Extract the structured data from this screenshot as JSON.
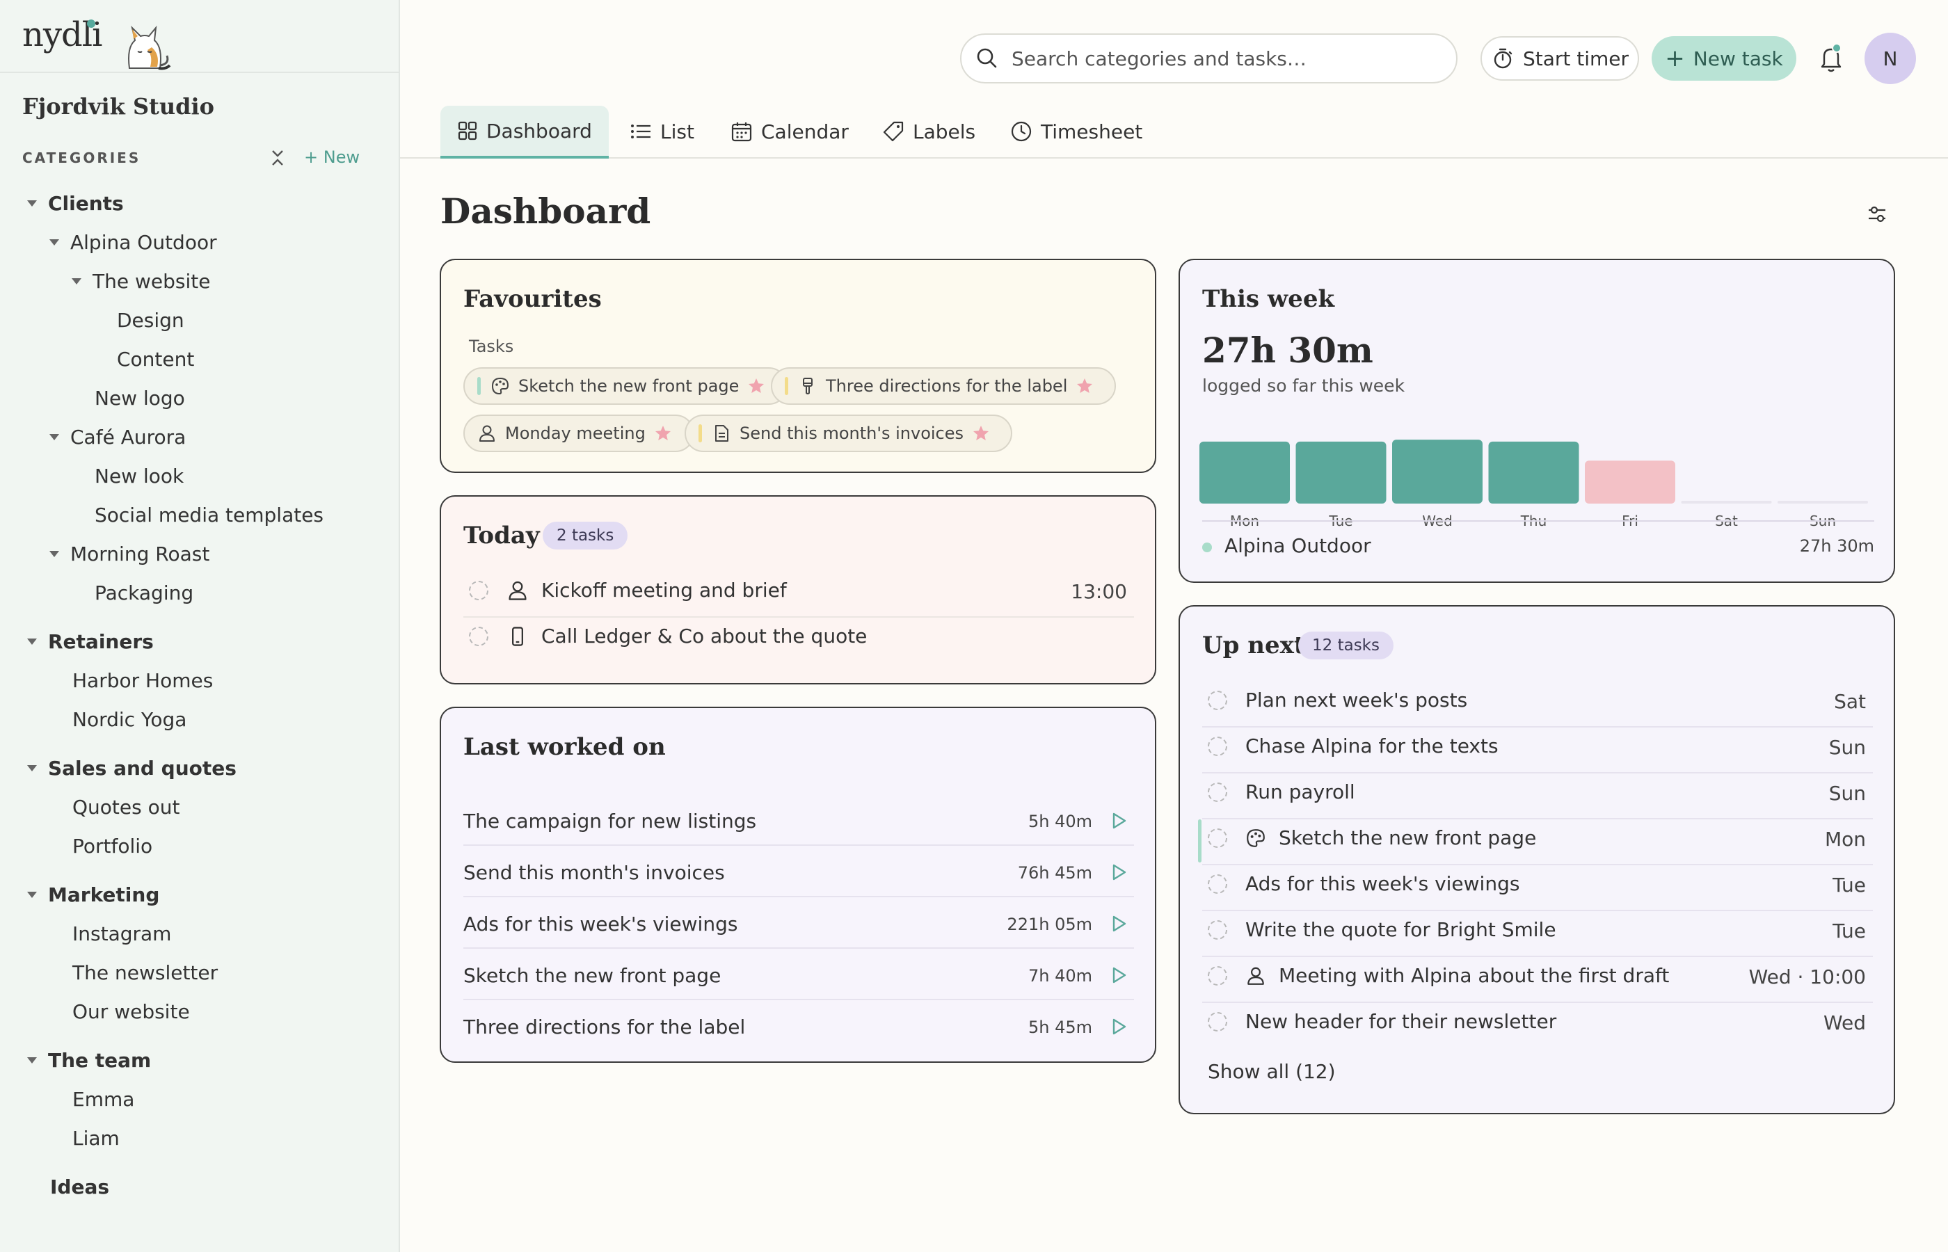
{
  "app": {
    "logo": "nydli",
    "workspace": "Fjordvik Studio"
  },
  "sidebar": {
    "categories_label": "CATEGORIES",
    "new_label": "+ New",
    "tree": [
      {
        "label": "Clients",
        "level": 0,
        "group": true,
        "caret": true
      },
      {
        "label": "Alpina Outdoor",
        "level": 1,
        "caret": true
      },
      {
        "label": "The website",
        "level": 2,
        "caret": true
      },
      {
        "label": "Design",
        "level": 3
      },
      {
        "label": "Content",
        "level": 3
      },
      {
        "label": "New logo",
        "level": 2
      },
      {
        "label": "Café Aurora",
        "level": 1,
        "caret": true
      },
      {
        "label": "New look",
        "level": 2
      },
      {
        "label": "Social media templates",
        "level": 2
      },
      {
        "label": "Morning Roast",
        "level": 1,
        "caret": true
      },
      {
        "label": "Packaging",
        "level": 2
      },
      {
        "label": "Retainers",
        "level": 0,
        "group": true,
        "caret": true
      },
      {
        "label": "Harbor Homes",
        "level": 1
      },
      {
        "label": "Nordic Yoga",
        "level": 1
      },
      {
        "label": "Sales and quotes",
        "level": 0,
        "group": true,
        "caret": true
      },
      {
        "label": "Quotes out",
        "level": 1
      },
      {
        "label": "Portfolio",
        "level": 1
      },
      {
        "label": "Marketing",
        "level": 0,
        "group": true,
        "caret": true
      },
      {
        "label": "Instagram",
        "level": 1
      },
      {
        "label": "The newsletter",
        "level": 1
      },
      {
        "label": "Our website",
        "level": 1
      },
      {
        "label": "The team",
        "level": 0,
        "group": true,
        "caret": true
      },
      {
        "label": "Emma",
        "level": 1
      },
      {
        "label": "Liam",
        "level": 1
      },
      {
        "label": "Ideas",
        "level": 0,
        "group": true
      }
    ]
  },
  "topbar": {
    "search_placeholder": "Search categories and tasks…",
    "start_timer": "Start timer",
    "new_task": "New task",
    "avatar_initial": "N"
  },
  "tabs": [
    {
      "label": "Dashboard",
      "icon": "grid-icon",
      "active": true
    },
    {
      "label": "List",
      "icon": "list-icon"
    },
    {
      "label": "Calendar",
      "icon": "calendar-icon"
    },
    {
      "label": "Labels",
      "icon": "tag-icon"
    },
    {
      "label": "Timesheet",
      "icon": "clock-icon"
    }
  ],
  "page": {
    "title": "Dashboard"
  },
  "favourites": {
    "title": "Favourites",
    "subtitle": "Tasks",
    "chips": [
      {
        "label": "Sketch the new front page",
        "bar_color": "#a8dcc9",
        "icon": "palette-icon"
      },
      {
        "label": "Three directions for the label",
        "bar_color": "#f3dc8a",
        "icon": "brush-icon"
      },
      {
        "label": "Monday meeting",
        "icon": "person-icon"
      },
      {
        "label": "Send this month's invoices",
        "bar_color": "#f3dc8a",
        "icon": "document-icon"
      }
    ]
  },
  "today": {
    "title": "Today",
    "badge": "2 tasks",
    "tasks": [
      {
        "label": "Kickoff meeting and brief",
        "time": "13:00",
        "icon": "person-icon"
      },
      {
        "label": "Call Ledger & Co about the quote",
        "time": "",
        "icon": "phone-icon"
      }
    ]
  },
  "last_worked": {
    "title": "Last worked on",
    "items": [
      {
        "label": "The campaign for new listings",
        "time": "5h 40m"
      },
      {
        "label": "Send this month's invoices",
        "time": "76h 45m"
      },
      {
        "label": "Ads for this week's viewings",
        "time": "221h 05m"
      },
      {
        "label": "Sketch the new front page",
        "time": "7h 40m"
      },
      {
        "label": "Three directions for the label",
        "time": "5h 45m"
      }
    ]
  },
  "this_week": {
    "title": "This week",
    "total": "27h 30m",
    "subtitle": "logged so far this week",
    "legend": {
      "name": "Alpina Outdoor",
      "value": "27h 30m",
      "color": "#a8dcc9"
    }
  },
  "chart_data": {
    "type": "bar",
    "categories": [
      "Mon",
      "Tue",
      "Wed",
      "Thu",
      "Fri",
      "Sat",
      "Sun"
    ],
    "values": [
      6.5,
      6.5,
      6.7,
      6.5,
      4.5,
      0,
      0
    ],
    "highlight_color": "#f3c1c6",
    "bar_color": "#5aa89b",
    "highlight_index": 4,
    "ylim": [
      0,
      7
    ],
    "grid": false
  },
  "up_next": {
    "title": "Up next",
    "badge": "12 tasks",
    "tasks": [
      {
        "label": "Plan next week's posts",
        "due": "Sat"
      },
      {
        "label": "Chase Alpina for the texts",
        "due": "Sun"
      },
      {
        "label": "Run payroll",
        "due": "Sun"
      },
      {
        "label": "Sketch the new front page",
        "due": "Mon",
        "icon": "palette-icon",
        "accent": true
      },
      {
        "label": "Ads for this week's viewings",
        "due": "Tue"
      },
      {
        "label": "Write the quote for Bright Smile",
        "due": "Tue"
      },
      {
        "label": "Meeting with Alpina about the first draft",
        "due": "Wed · 10:00",
        "icon": "person-icon"
      },
      {
        "label": "New header for their newsletter",
        "due": "Wed"
      }
    ],
    "show_all": "Show all (12)"
  }
}
